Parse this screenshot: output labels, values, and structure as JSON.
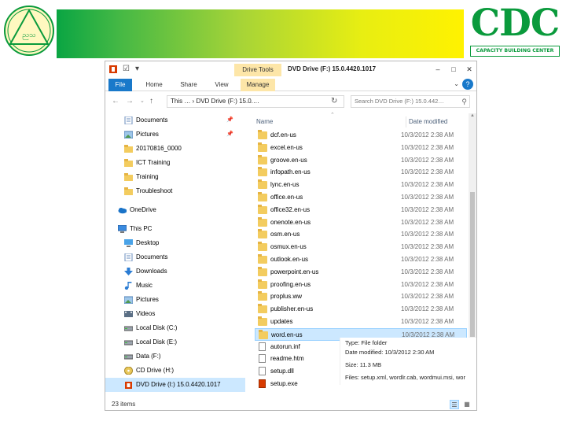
{
  "colors": {
    "accent": "#1979ca",
    "selection": "#cce8ff",
    "folder": "#f3cc5f",
    "drive_tools": "#fde6a8",
    "brand_green": "#0a9a3c"
  },
  "header": {
    "left_logo_text": "ညသ",
    "right_logo": {
      "letters": "CDC",
      "subtitle": "CAPACITY BUILDING CENTER"
    }
  },
  "window": {
    "contextual_tab": "Drive Tools",
    "title": "DVD Drive (F:) 15.0.4420.1017",
    "ribbon_tabs": [
      "File",
      "Home",
      "Share",
      "View",
      "Manage"
    ],
    "address": "This … › DVD Drive (F:) 15.0.…",
    "search_placeholder": "Search DVD Drive (F:) 15.0.442…"
  },
  "nav": [
    {
      "label": "Documents",
      "icon": "documents-icon",
      "pinned": true
    },
    {
      "label": "Pictures",
      "icon": "pictures-icon",
      "pinned": true
    },
    {
      "label": "20170816_0000",
      "icon": "folder-icon"
    },
    {
      "label": "ICT Training",
      "icon": "folder-icon"
    },
    {
      "label": "Training",
      "icon": "folder-icon"
    },
    {
      "label": "Troubleshoot",
      "icon": "folder-icon"
    },
    {
      "label": "OneDrive",
      "icon": "onedrive-icon"
    },
    {
      "label": "This PC",
      "icon": "computer-icon"
    },
    {
      "label": "Desktop",
      "icon": "desktop-icon"
    },
    {
      "label": "Documents",
      "icon": "documents-icon"
    },
    {
      "label": "Downloads",
      "icon": "downloads-icon"
    },
    {
      "label": "Music",
      "icon": "music-icon"
    },
    {
      "label": "Pictures",
      "icon": "pictures-icon"
    },
    {
      "label": "Videos",
      "icon": "videos-icon"
    },
    {
      "label": "Local Disk (C:)",
      "icon": "local-disk-icon"
    },
    {
      "label": "Local Disk (E:)",
      "icon": "local-disk-icon"
    },
    {
      "label": "Data (F:)",
      "icon": "local-disk-icon"
    },
    {
      "label": "CD Drive (H:)",
      "icon": "cd-drive-icon"
    },
    {
      "label": "DVD Drive (I:) 15.0.4420.1017",
      "icon": "dvd-drive-icon",
      "selected": true
    }
  ],
  "columns": {
    "name": "Name",
    "date": "Date modified"
  },
  "files": [
    {
      "name": "dcf.en-us",
      "date": "10/3/2012 2:38 AM",
      "type": "folder"
    },
    {
      "name": "excel.en-us",
      "date": "10/3/2012 2:38 AM",
      "type": "folder"
    },
    {
      "name": "groove.en-us",
      "date": "10/3/2012 2:38 AM",
      "type": "folder"
    },
    {
      "name": "infopath.en-us",
      "date": "10/3/2012 2:38 AM",
      "type": "folder"
    },
    {
      "name": "lync.en-us",
      "date": "10/3/2012 2:38 AM",
      "type": "folder"
    },
    {
      "name": "office.en-us",
      "date": "10/3/2012 2:38 AM",
      "type": "folder"
    },
    {
      "name": "office32.en-us",
      "date": "10/3/2012 2:38 AM",
      "type": "folder"
    },
    {
      "name": "onenote.en-us",
      "date": "10/3/2012 2:38 AM",
      "type": "folder"
    },
    {
      "name": "osm.en-us",
      "date": "10/3/2012 2:38 AM",
      "type": "folder"
    },
    {
      "name": "osmux.en-us",
      "date": "10/3/2012 2:38 AM",
      "type": "folder"
    },
    {
      "name": "outlook.en-us",
      "date": "10/3/2012 2:38 AM",
      "type": "folder"
    },
    {
      "name": "powerpoint.en-us",
      "date": "10/3/2012 2:38 AM",
      "type": "folder"
    },
    {
      "name": "proofing.en-us",
      "date": "10/3/2012 2:38 AM",
      "type": "folder"
    },
    {
      "name": "proplus.ww",
      "date": "10/3/2012 2:38 AM",
      "type": "folder"
    },
    {
      "name": "publisher.en-us",
      "date": "10/3/2012 2:38 AM",
      "type": "folder"
    },
    {
      "name": "updates",
      "date": "10/3/2012 2:38 AM",
      "type": "folder"
    },
    {
      "name": "word.en-us",
      "date": "10/3/2012 2:38 AM",
      "type": "folder",
      "selected": true
    },
    {
      "name": "autorun.inf",
      "date": "",
      "type": "file"
    },
    {
      "name": "readme.htm",
      "date": "",
      "type": "file"
    },
    {
      "name": "setup.dll",
      "date": "",
      "type": "file"
    },
    {
      "name": "setup.exe",
      "date": "",
      "type": "exe"
    }
  ],
  "details": {
    "type": "Type: File folder",
    "modified": "Date modified: 10/3/2012 2:30 AM",
    "size": "Size: 11.3 MB",
    "files": "Files: setup.xml, wordlr.cab, wordmui.msi, wor"
  },
  "status": {
    "count": "23 items"
  }
}
